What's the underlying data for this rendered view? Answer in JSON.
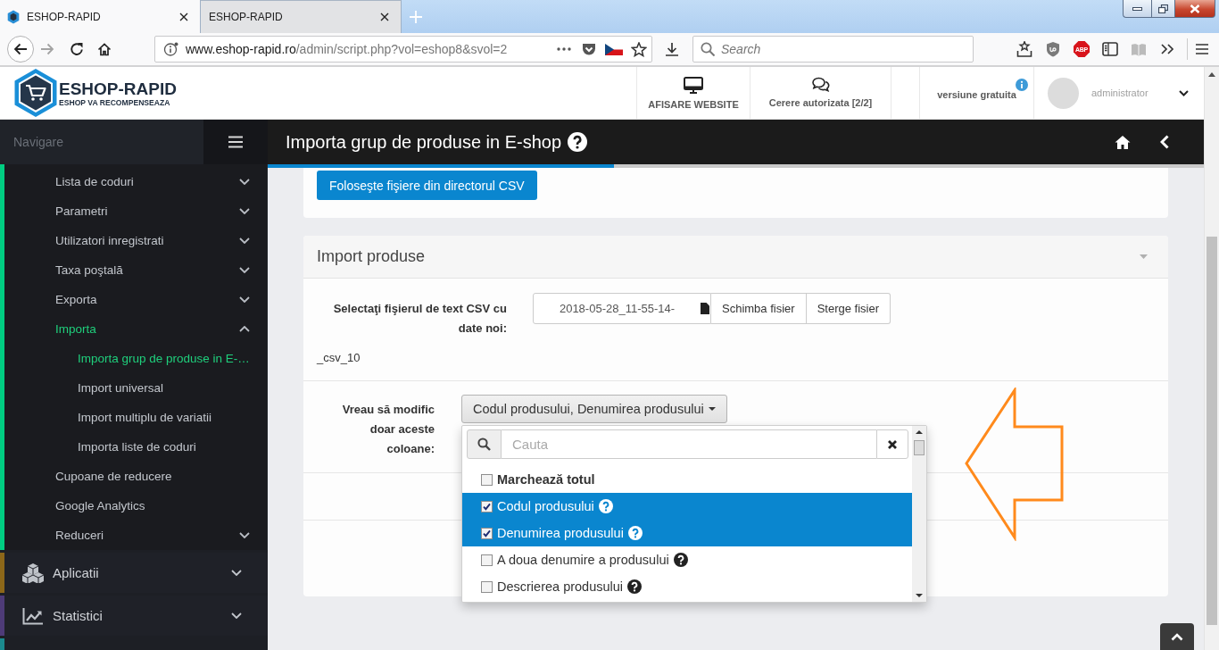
{
  "browser": {
    "tabs": [
      {
        "title": "ESHOP-RAPID",
        "selected": true,
        "favicon": true
      },
      {
        "title": "ESHOP-RAPID",
        "selected": false,
        "favicon": false
      }
    ],
    "address": {
      "host": "www.eshop-rapid.ro",
      "path": "/admin/script.php?vol=eshop8&svol=2"
    },
    "search": {
      "placeholder": "Search"
    },
    "extension_badge": "ABP"
  },
  "header": {
    "logo": {
      "name": "ESHOP-RAPID",
      "tagline": "ESHOP VA RECOMPENSEAZA"
    },
    "links": [
      {
        "label": "AFISARE WEBSITE"
      },
      {
        "label": "Cerere autorizata [2/2]"
      }
    ],
    "plan": "versiune gratuita",
    "user": "administrator"
  },
  "sidebar": {
    "heading": "Navigare",
    "sections": [
      {
        "color": "#00ce82",
        "items": [
          {
            "label": "Lista de coduri",
            "expandable": true,
            "expanded": false,
            "selected": false
          },
          {
            "label": "Parametri",
            "expandable": true,
            "expanded": false,
            "selected": false
          },
          {
            "label": "Utilizatori inregistrati",
            "expandable": true,
            "expanded": false,
            "selected": false
          },
          {
            "label": "Taxa poştală",
            "expandable": true,
            "expanded": false,
            "selected": false
          },
          {
            "label": "Exporta",
            "expandable": true,
            "expanded": false,
            "selected": false
          },
          {
            "label": "Importa",
            "expandable": true,
            "expanded": true,
            "selected": true,
            "children": [
              {
                "label": "Importa grup de produse in E-…",
                "selected": true
              },
              {
                "label": "Import universal",
                "selected": false
              },
              {
                "label": "Import multiplu de variatii",
                "selected": false
              },
              {
                "label": "Importa liste de coduri",
                "selected": false
              }
            ]
          },
          {
            "label": "Cupoane de reducere",
            "expandable": false,
            "selected": false
          },
          {
            "label": "Google Analytics",
            "expandable": false,
            "selected": false
          },
          {
            "label": "Reduceri",
            "expandable": true,
            "expanded": false,
            "selected": false
          }
        ]
      },
      {
        "label": "Aplicatii",
        "color": "#8c6719",
        "expanded": false
      },
      {
        "label": "Statistici",
        "color": "#4e3b78",
        "expanded": false
      },
      {
        "color": "#1b8a8e"
      }
    ]
  },
  "title_bar": {
    "title": "Importa grup de produse in E-shop",
    "progress": {
      "level": 0.37
    }
  },
  "main": {
    "csv_button": "Foloseşte fişiere din directorul CSV",
    "import_panel": {
      "title": "Import produse",
      "file_row": {
        "label": "Selectaţi fişierul de text CSV cu date noi:",
        "file_name": "2018-05-28_11-55-14-",
        "buttons": [
          "Schimba fisier",
          "Sterge fisier"
        ],
        "file_name_rest": "_csv_10"
      },
      "columns_row": {
        "label": "Vreau să modific doar aceste coloane:",
        "dropdown": {
          "value": "Codul produsului, Denumirea produsului",
          "expanded": true,
          "search": {
            "placeholder": "Cauta"
          },
          "options": [
            {
              "label": "Marchează totul",
              "kind": "select-all",
              "checked": false,
              "selected": false
            },
            {
              "label": "Codul produsului",
              "kind": "option",
              "checked": true,
              "selected": true
            },
            {
              "label": "Denumirea produsului",
              "kind": "option",
              "checked": true,
              "selected": true
            },
            {
              "label": "A doua denumire a produsului",
              "kind": "option",
              "checked": false,
              "selected": false
            },
            {
              "label": "Descrierea produsului",
              "kind": "option",
              "checked": false,
              "selected": false
            }
          ]
        }
      }
    }
  }
}
